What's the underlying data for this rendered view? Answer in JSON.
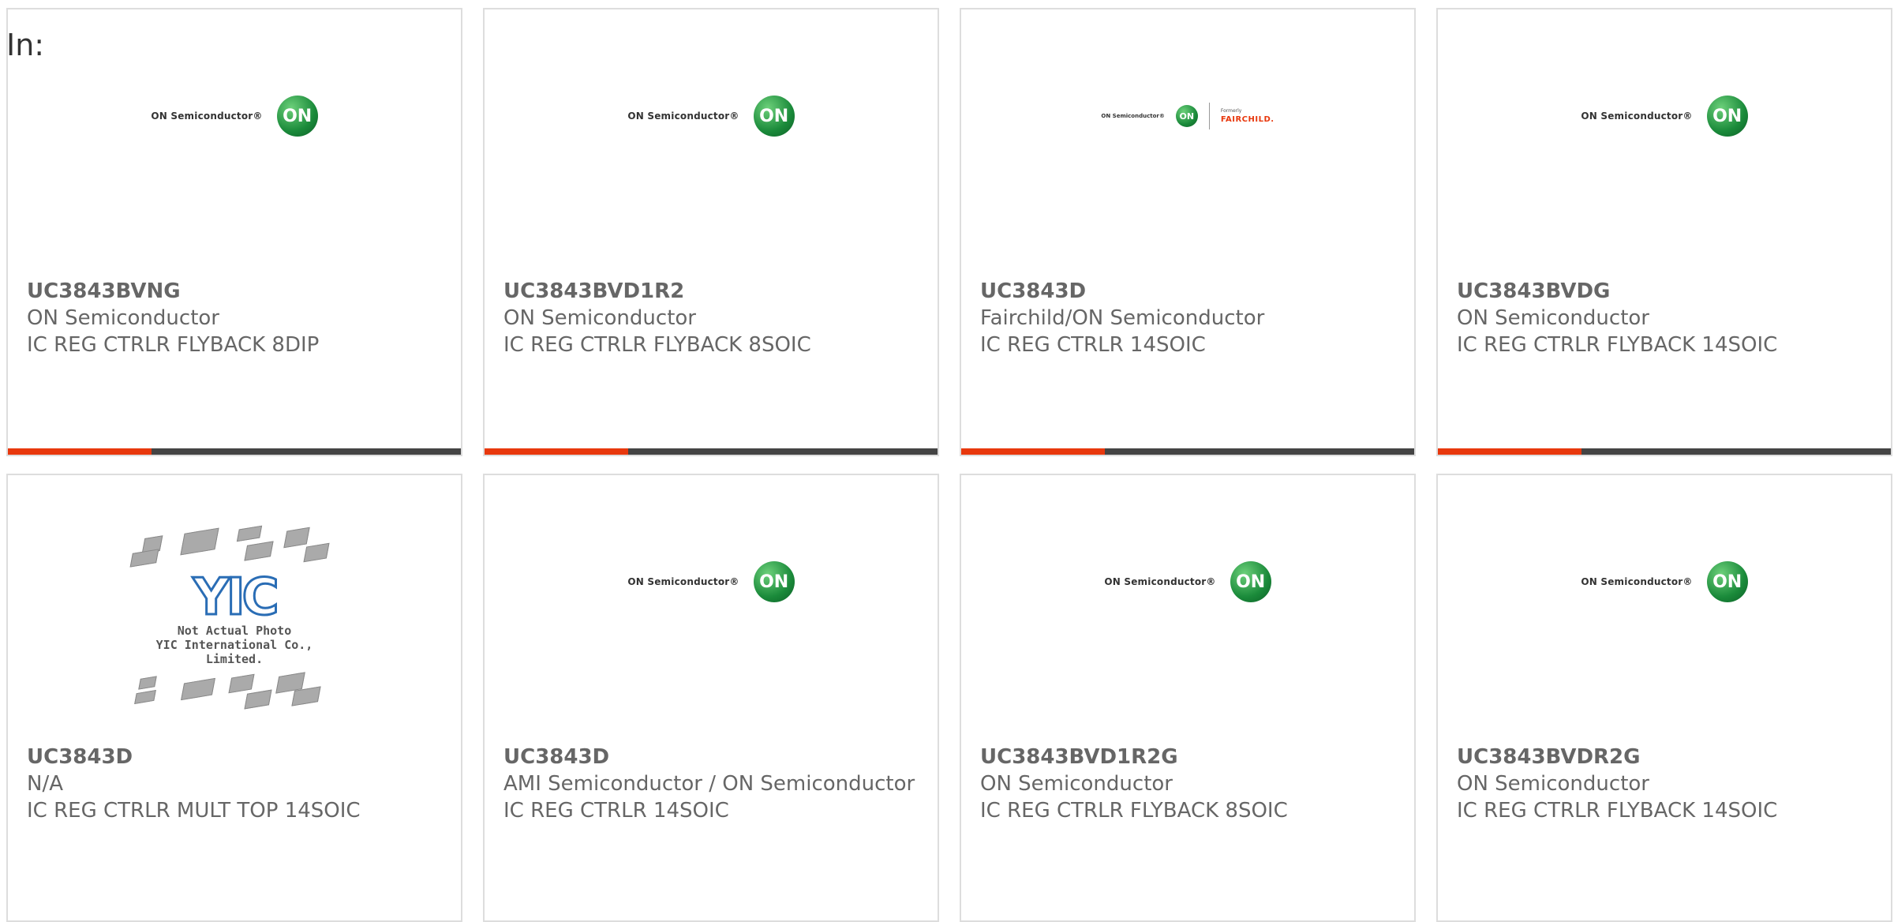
{
  "filter_label": "In:",
  "products": [
    {
      "part": "UC3843BVNG",
      "manufacturer": "ON Semiconductor",
      "description": "IC REG CTRLR FLYBACK 8DIP",
      "image": "on-semiconductor-logo"
    },
    {
      "part": "UC3843BVD1R2",
      "manufacturer": "ON Semiconductor",
      "description": "IC REG CTRLR FLYBACK 8SOIC",
      "image": "on-semiconductor-logo"
    },
    {
      "part": "UC3843D",
      "manufacturer": "Fairchild/ON Semiconductor",
      "description": "IC REG CTRLR 14SOIC",
      "image": "fairchild-on-logo"
    },
    {
      "part": "UC3843BVDG",
      "manufacturer": "ON Semiconductor",
      "description": "IC REG CTRLR FLYBACK 14SOIC",
      "image": "on-semiconductor-logo"
    },
    {
      "part": "UC3843D",
      "manufacturer": "N/A",
      "description": "IC REG CTRLR MULT TOP 14SOIC",
      "image": "yic-placeholder"
    },
    {
      "part": "UC3843D",
      "manufacturer": "AMI Semiconductor / ON Semiconductor",
      "description": "IC REG CTRLR 14SOIC",
      "image": "on-semiconductor-logo"
    },
    {
      "part": "UC3843BVD1R2G",
      "manufacturer": "ON Semiconductor",
      "description": "IC REG CTRLR FLYBACK 8SOIC",
      "image": "on-semiconductor-logo"
    },
    {
      "part": "UC3843BVDR2G",
      "manufacturer": "ON Semiconductor",
      "description": "IC REG CTRLR FLYBACK 14SOIC",
      "image": "on-semiconductor-logo"
    }
  ],
  "logos": {
    "on_text": "ON Semiconductor®",
    "on_mark": "ON",
    "fairchild_small": "Formerly",
    "fairchild_name": "FAIRCHILD.",
    "yic_mark": "YIC",
    "yic_caption_1": "Not Actual Photo",
    "yic_caption_2": "YIC International Co., Limited."
  },
  "colors": {
    "accent": "#e8380d",
    "bar": "#444444",
    "text": "#666666"
  }
}
